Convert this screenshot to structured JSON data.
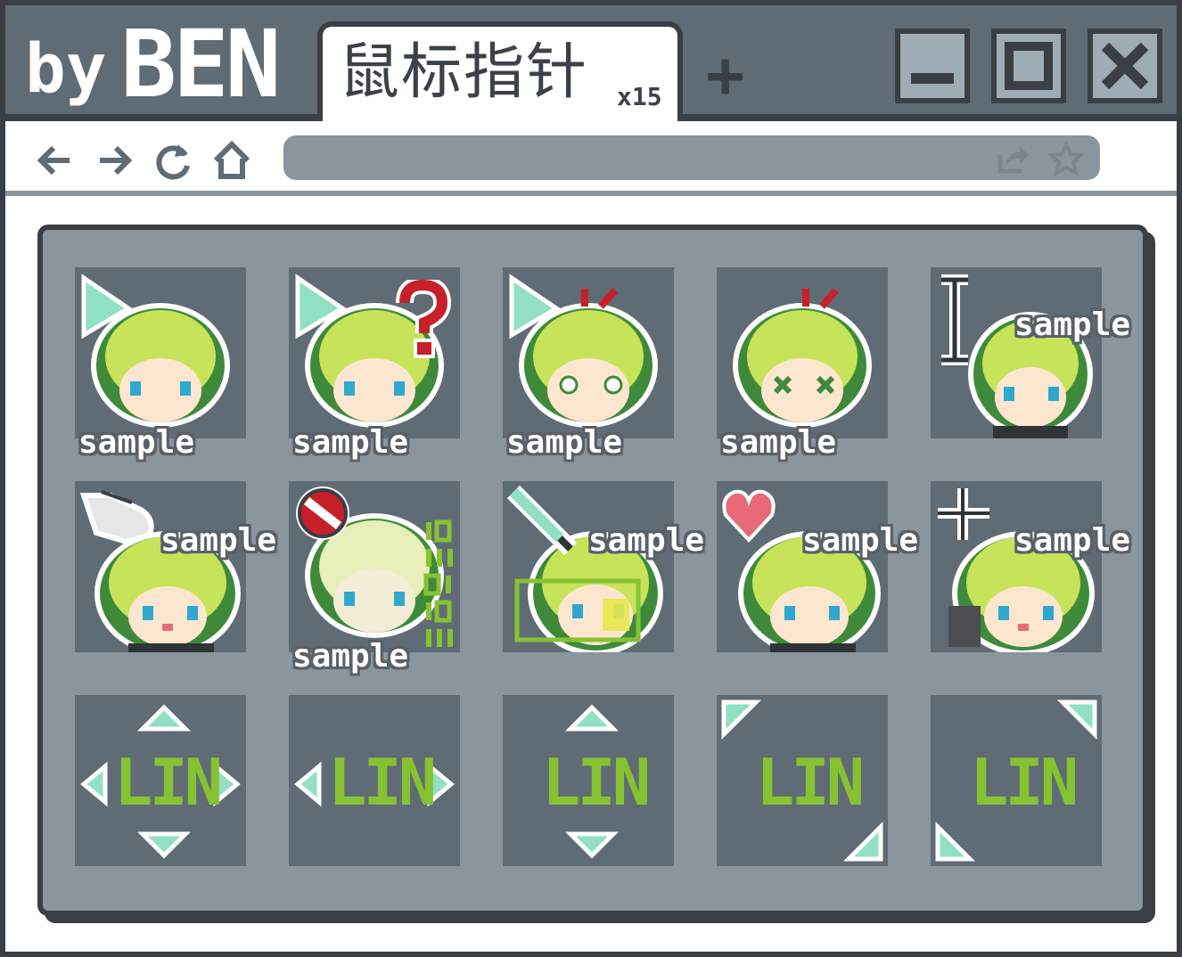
{
  "window": {
    "brand_prefix": "by",
    "brand_name": "BEN",
    "tab_title": "鼠标指针",
    "tab_count": "x15",
    "new_tab_label": "+"
  },
  "toolbar": {
    "icons": [
      "back-arrow-icon",
      "forward-arrow-icon",
      "reload-icon",
      "home-icon"
    ],
    "address_icons": [
      "share-icon",
      "star-icon"
    ]
  },
  "cursors": {
    "watermark": "sample",
    "resize_label": "LIN",
    "items": [
      {
        "name": "normal-select",
        "overlay": "arrow-icon"
      },
      {
        "name": "help-select",
        "overlay": "question-mark-icon"
      },
      {
        "name": "working-in-background",
        "overlay": "arrow-icon"
      },
      {
        "name": "busy",
        "overlay": "none"
      },
      {
        "name": "text-select",
        "overlay": "i-beam-icon"
      },
      {
        "name": "link-select",
        "overlay": "pointing-hand-icon"
      },
      {
        "name": "unavailable",
        "overlay": "no-entry-icon"
      },
      {
        "name": "handwriting",
        "overlay": "pen-icon"
      },
      {
        "name": "alternate-select",
        "overlay": "heart-icon"
      },
      {
        "name": "precision-select",
        "overlay": "crosshair-icon"
      },
      {
        "name": "move",
        "overlay": "four-way-arrows-icon"
      },
      {
        "name": "horizontal-resize",
        "overlay": "left-right-arrows-icon"
      },
      {
        "name": "vertical-resize",
        "overlay": "up-down-arrows-icon"
      },
      {
        "name": "diagonal-resize-1",
        "overlay": "nw-se-arrows-icon"
      },
      {
        "name": "diagonal-resize-2",
        "overlay": "ne-sw-arrows-icon"
      }
    ]
  },
  "colors": {
    "frame": "#3a3e45",
    "titlebar": "#5f6b75",
    "panel": "#8a959d",
    "cell": "#5f6b75",
    "accent_mint": "#8fe0c4",
    "accent_green": "#86c232",
    "heart": "#e86a78",
    "stop": "#c8202a"
  }
}
